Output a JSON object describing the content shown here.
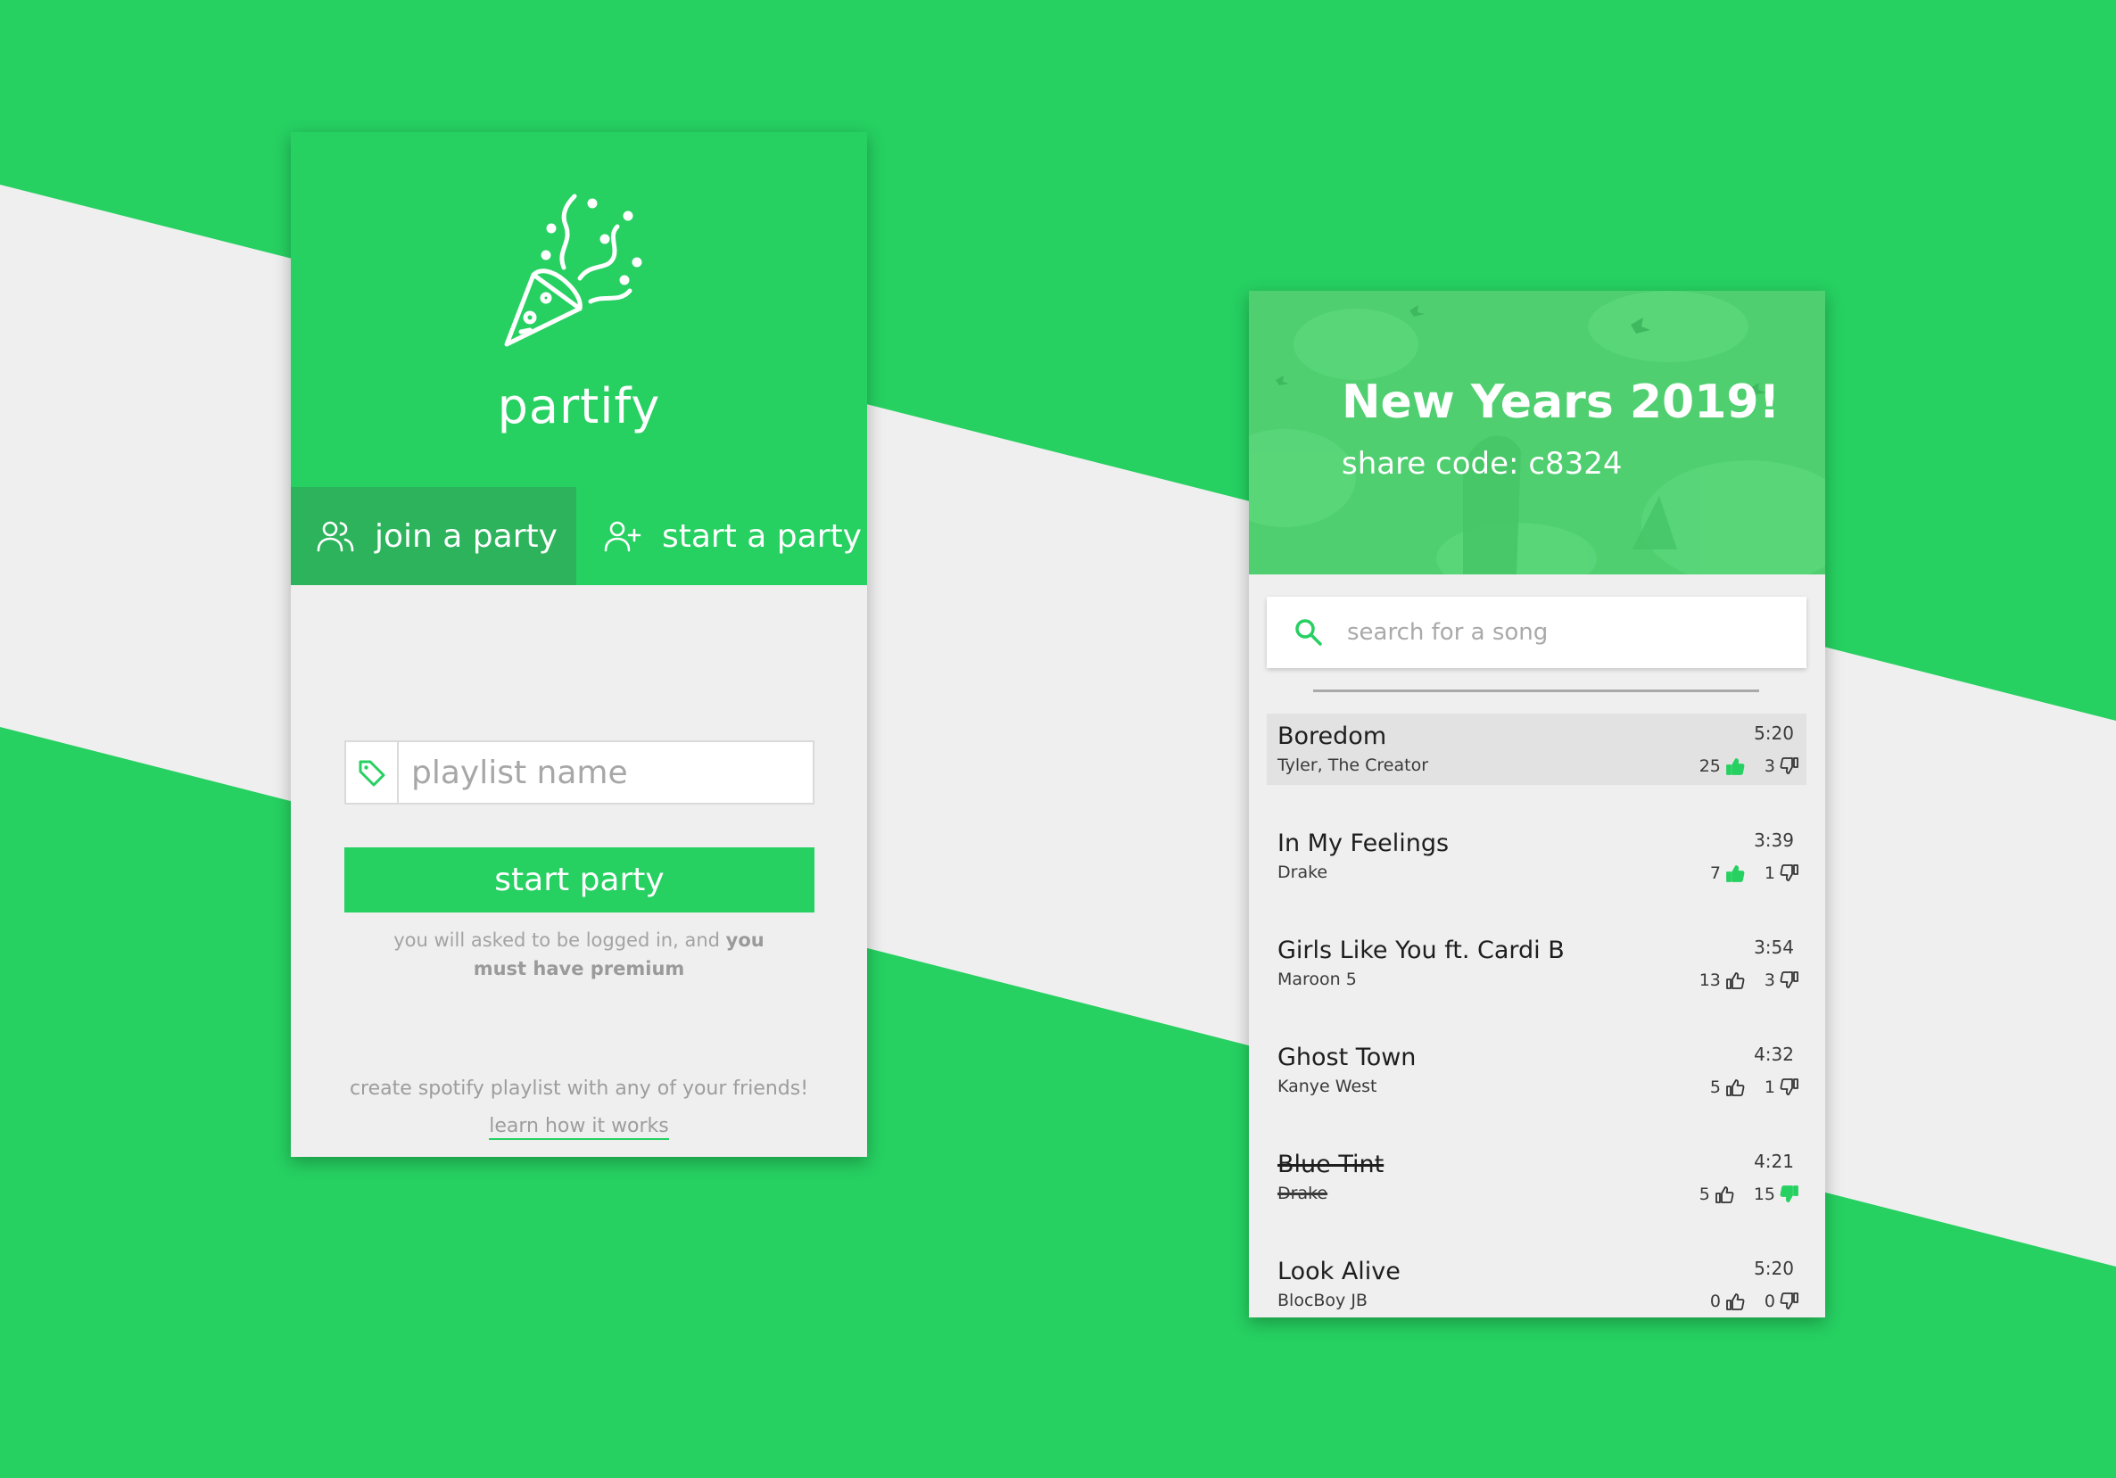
{
  "colors": {
    "brand_green": "#26d061",
    "tab_active": "#2db35c",
    "band_gray": "#efefef",
    "hero_green": "#4fcf6f"
  },
  "left_screen": {
    "logo_icon": "party-popper-icon",
    "brand": "partify",
    "tabs": [
      {
        "label": "join a party",
        "icon": "group-icon",
        "active": true
      },
      {
        "label": "start a party",
        "icon": "add-user-icon",
        "active": false
      }
    ],
    "playlist_input": {
      "placeholder": "playlist name",
      "value": "",
      "icon": "tag-icon"
    },
    "start_button_label": "start party",
    "note_plain": "you will asked to be logged in, and",
    "note_bold": "you must have premium",
    "tagline": "create spotify playlist with any of your friends!",
    "learn_link": "learn how it works"
  },
  "right_screen": {
    "party_title": "New Years 2019!",
    "share_code": "share code: c8324",
    "search": {
      "placeholder": "search for a song",
      "value": "",
      "icon": "search-icon"
    },
    "songs": [
      {
        "title": "Boredom",
        "artist": "Tyler, The Creator",
        "duration": "5:20",
        "upvotes": "25",
        "downvotes": "3",
        "upvoted": true,
        "downvoted": false,
        "struck": false,
        "highlighted": true
      },
      {
        "title": "In My Feelings",
        "artist": "Drake",
        "duration": "3:39",
        "upvotes": "7",
        "downvotes": "1",
        "upvoted": true,
        "downvoted": false,
        "struck": false,
        "highlighted": false
      },
      {
        "title": "Girls Like You ft. Cardi B",
        "artist": "Maroon 5",
        "duration": "3:54",
        "upvotes": "13",
        "downvotes": "3",
        "upvoted": false,
        "downvoted": false,
        "struck": false,
        "highlighted": false
      },
      {
        "title": "Ghost Town",
        "artist": "Kanye West",
        "duration": "4:32",
        "upvotes": "5",
        "downvotes": "1",
        "upvoted": false,
        "downvoted": false,
        "struck": false,
        "highlighted": false
      },
      {
        "title": "Blue Tint",
        "artist": "Drake",
        "duration": "4:21",
        "upvotes": "5",
        "downvotes": "15",
        "upvoted": false,
        "downvoted": true,
        "struck": true,
        "highlighted": false
      },
      {
        "title": "Look Alive",
        "artist": "BlocBoy JB",
        "duration": "5:20",
        "upvotes": "0",
        "downvotes": "0",
        "upvoted": false,
        "downvoted": false,
        "struck": false,
        "highlighted": false
      }
    ]
  }
}
